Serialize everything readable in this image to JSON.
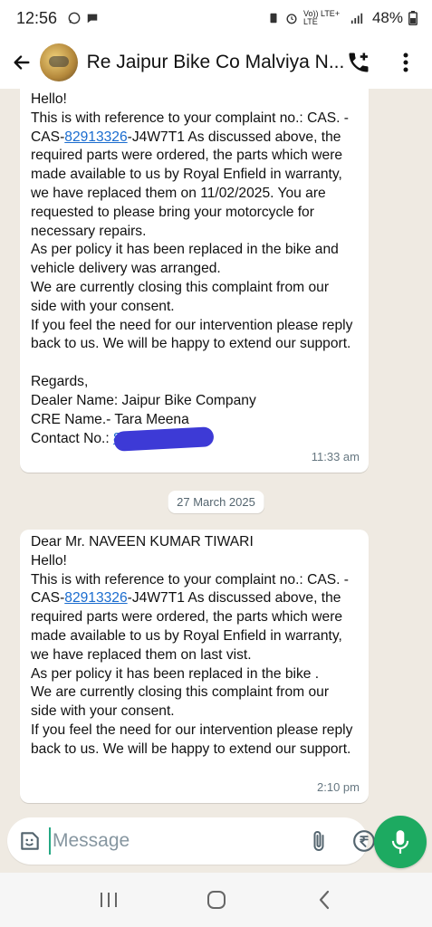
{
  "status_bar": {
    "time": "12:56",
    "battery": "48%",
    "network": "Vo)) LTE+ LTE"
  },
  "header": {
    "title": "Re Jaipur Bike Co Malviya N..."
  },
  "messages": [
    {
      "pre": "Hello!\nThis is with reference to your complaint no.: CAS. - CAS-",
      "link": "82913326",
      "post": "-J4W7T1 As discussed above, the required parts were ordered, the parts which were made available to us by Royal Enfield in warranty, we have replaced them on 11/02/2025. You are requested to please bring your motorcycle for necessary repairs.\nAs per policy it has been replaced in the bike and vehicle delivery was arranged.\nWe are currently closing this complaint from our side with your consent.\nIf you feel the need for our intervention please reply back to us. We will be happy to extend our support.\n\nRegards,\nDealer Name: Jaipur Bike Company\nCRE Name.- Tara Meena\nContact No.: ",
      "contact_visible": "8",
      "time": "11:33 am"
    },
    {
      "pre": "Dear Mr. NAVEEN KUMAR TIWARI\nHello!\nThis is with reference to your complaint no.: CAS. - CAS-",
      "link": "82913326",
      "post": "-J4W7T1 As discussed above, the required parts were ordered, the parts which were made available to us by Royal Enfield in warranty, we have replaced them on last vist.\nAs per policy it has been replaced in the bike .\nWe are currently closing this complaint from our side with your consent.\nIf you feel the need for our intervention please reply back to us. We will be happy to extend our support.",
      "time": "2:10 pm"
    }
  ],
  "date_separator": "27 March 2025",
  "input": {
    "placeholder": "Message"
  },
  "colors": {
    "accent": "#1daa61",
    "link": "#1a6ccf",
    "chat_bg": "#efeae2",
    "redaction": "#3d3ad6"
  },
  "icons": {
    "back": "arrow-left-icon",
    "add_call": "phone-plus-icon",
    "menu": "more-vertical-icon",
    "sticker": "sticker-icon",
    "attach": "paperclip-icon",
    "payment": "rupee-icon",
    "camera": "camera-icon",
    "mic": "mic-icon"
  }
}
